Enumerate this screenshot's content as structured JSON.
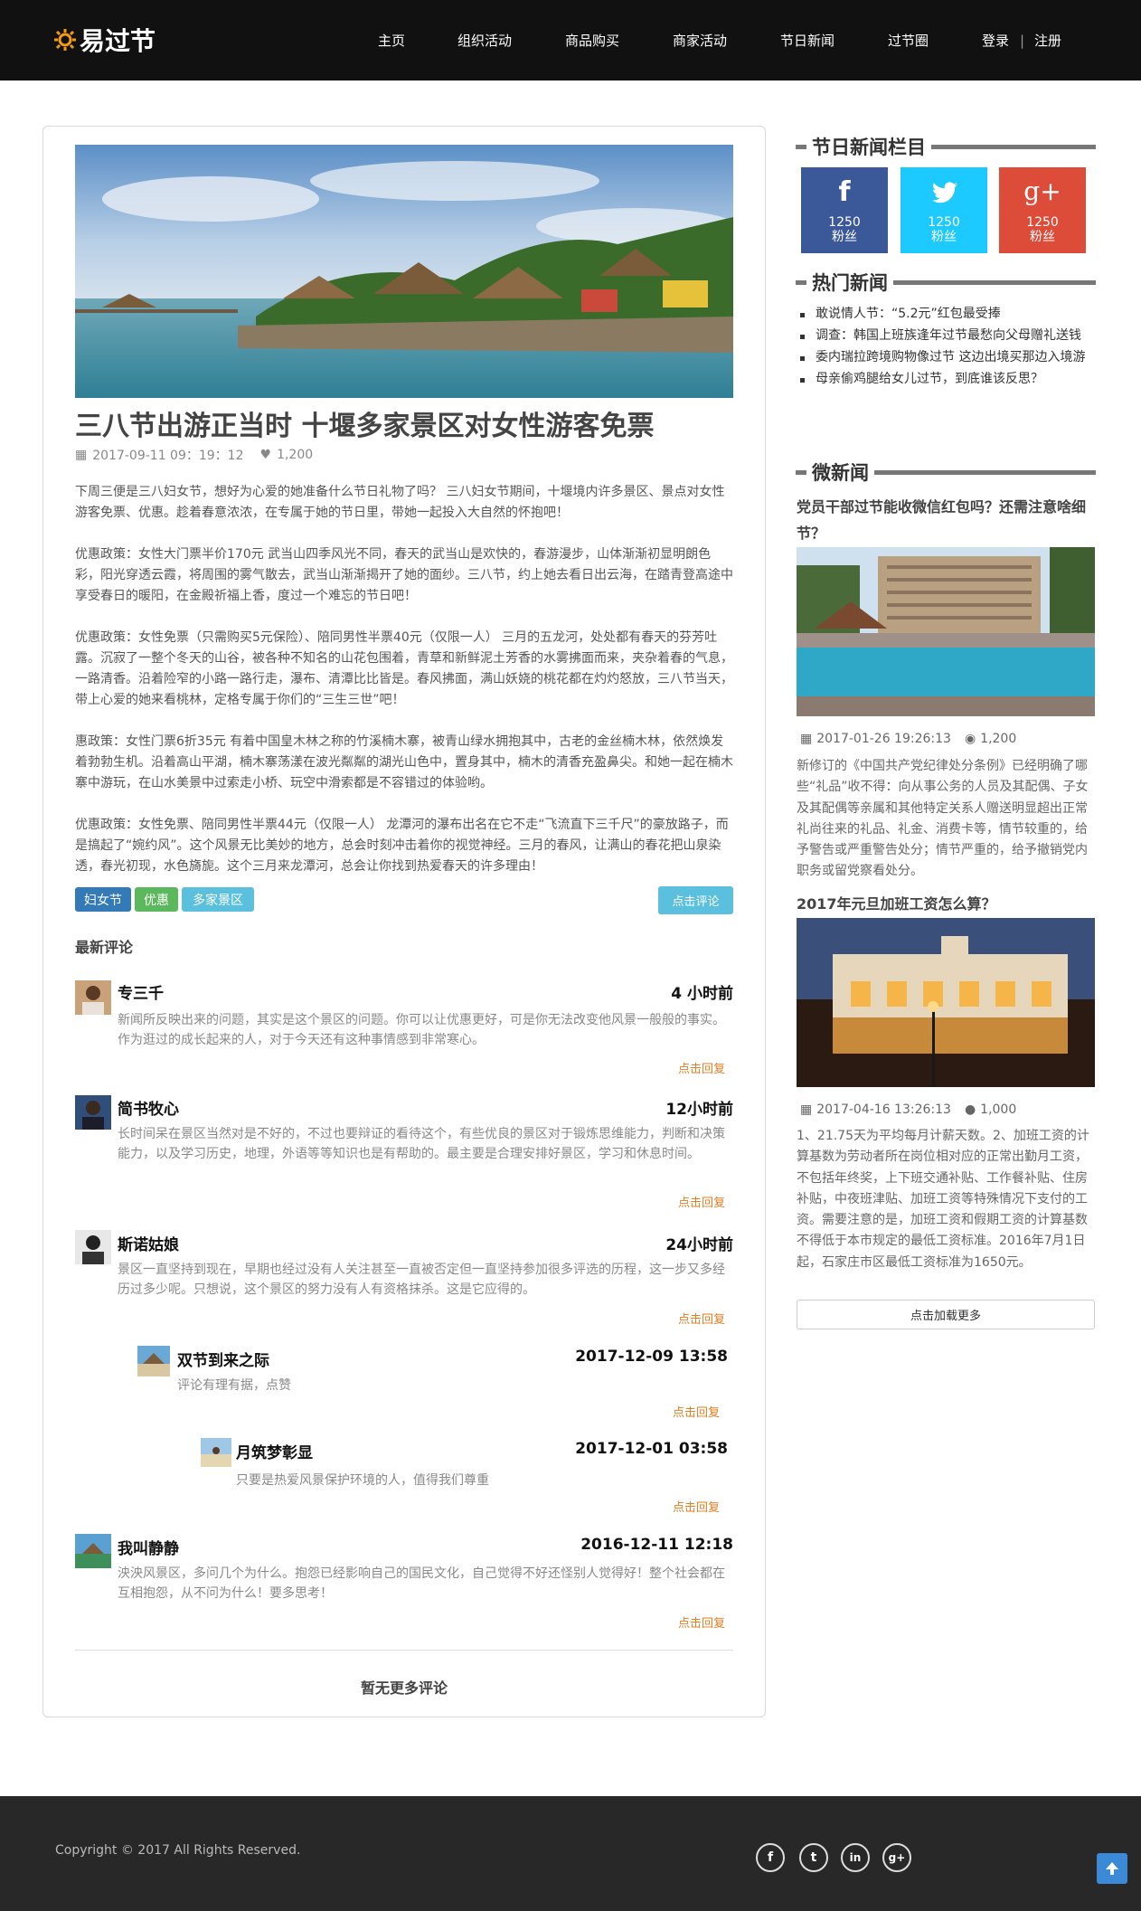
{
  "nav": {
    "logo_text": "易过节",
    "items": [
      "主页",
      "组织活动",
      "商品购买",
      "商家活动",
      "节日新闻",
      "过节圈"
    ],
    "login": "登录",
    "separator": "|",
    "register": "注册"
  },
  "article": {
    "title": "三八节出游正当时 十堰多家景区对女性游客免票",
    "date": "2017-09-11 09：19：12",
    "likes": "1,200",
    "paragraphs": [
      "下周三便是三八妇女节，想好为心爱的她准备什么节日礼物了吗？ 三八妇女节期间，十堰境内许多景区、景点对女性游客免票、优惠。趁着春意浓浓，在专属于她的节日里，带她一起投入大自然的怀抱吧！",
      "优惠政策：女性大门票半价170元 武当山四季风光不同，春天的武当山是欢快的，春游漫步，山体渐渐初显明朗色彩，阳光穿透云霞，将周围的雾气散去，武当山渐渐揭开了她的面纱。三八节，约上她去看日出云海，在踏青登高途中享受春日的暖阳，在金殿祈福上香，度过一个难忘的节日吧！",
      "优惠政策：女性免票（只需购买5元保险）、陪同男性半票40元（仅限一人） 三月的五龙河，处处都有春天的芬芳吐露。沉寂了一整个冬天的山谷，被各种不知名的山花包围着，青草和新鲜泥土芳香的水雾拂面而来，夹杂着春的气息，一路清香。沿着险窄的小路一路行走，瀑布、清潭比比皆是。春风拂面，满山妖娆的桃花都在灼灼怒放，三八节当天，带上心爱的她来看桃林，定格专属于你们的“三生三世”吧！",
      "惠政策：女性门票6折35元 有着中国皇木林之称的竹溪楠木寨，被青山绿水拥抱其中，古老的金丝楠木林，依然焕发着勃勃生机。沿着高山平湖，楠木寨荡漾在波光粼粼的湖光山色中，置身其中，楠木的清香充盈鼻尖。和她一起在楠木寨中游玩，在山水美景中过索走小桥、玩空中滑索都是不容错过的体验哟。",
      "优惠政策：女性免票、陪同男性半票44元（仅限一人） 龙潭河的瀑布出名在它不走“飞流直下三千尺”的豪放路子，而是搞起了“婉约风”。这个风景无比美妙的地方，总会时刻冲击着你的视觉神经。三月的春风，让满山的春花把山泉染透，春光初现，水色旖旎。这个三月来龙潭河，总会让你找到热爱春天的许多理由！"
    ],
    "tags": [
      "妇女节",
      "优惠",
      "多家景区"
    ],
    "comment_button": "点击评论"
  },
  "comments": {
    "heading": "最新评论",
    "items": [
      {
        "name": "专三千",
        "time": "4 小时前",
        "text": "新闻所反映出来的问题，其实是这个景区的问题。你可以让优惠更好，可是你无法改变他风景一般般的事实。作为逛过的成长起来的人，对于今天还有这种事情感到非常寒心。",
        "reply": "点击回复"
      },
      {
        "name": "简书牧心",
        "time": "12小时前",
        "text": "长时间呆在景区当然对是不好的，不过也要辩证的看待这个，有些优良的景区对于锻炼思维能力，判断和决策能力，以及学习历史，地理，外语等等知识也是有帮助的。最主要是合理安排好景区，学习和休息时间。",
        "reply": "点击回复"
      },
      {
        "name": "斯诺姑娘",
        "time": "24小时前",
        "text": "景区一直坚持到现在，早期也经过没有人关注甚至一直被否定但一直坚持参加很多评选的历程，这一步又多经历过多少呢。只想说，这个景区的努力没有人有资格抹杀。这是它应得的。",
        "reply": "点击回复"
      },
      {
        "name": "双节到来之际",
        "time": "2017-12-09 13:58",
        "text": "评论有理有据，点赞",
        "reply": "点击回复"
      },
      {
        "name": "月筑梦彰显",
        "time": "2017-12-01 03:58",
        "text": "只要是热爱风景保护环境的人，值得我们尊重",
        "reply": "点击回复"
      },
      {
        "name": "我叫静静",
        "time": "2016-12-11 12:18",
        "text": "泱泱风景区，多问几个为什么。抱怨已经影响自己的国民文化，自己觉得不好还怪别人觉得好！整个社会都在互相抱怨，从不问为什么！要多思考！",
        "reply": "点击回复"
      }
    ],
    "no_more": "暂无更多评论"
  },
  "sidebar": {
    "section1": "节日新闻栏目",
    "social": [
      {
        "icon": "facebook-icon",
        "count": "1250",
        "label": "粉丝",
        "color": "#3b5998"
      },
      {
        "icon": "twitter-icon",
        "count": "1250",
        "label": "粉丝",
        "color": "#1dcaff"
      },
      {
        "icon": "google-plus-icon",
        "count": "1250",
        "label": "粉丝",
        "color": "#dd4b39"
      }
    ],
    "section2": "热门新闻",
    "hot": [
      "敢说情人节：“5.2元”红包最受捧",
      "调查：韩国上班族逢年过节最愁向父母赠礼送钱",
      "委内瑞拉跨境购物像过节 这边出境买那边入境游",
      "母亲偷鸡腿给女儿过节，到底谁该反思？"
    ],
    "section3": "微新闻",
    "news": [
      {
        "title": "党员干部过节能收微信红包吗？还需注意啥细节？",
        "date": "2017-01-26 19:26:13",
        "count": "1,200",
        "text": "新修订的《中国共产党纪律处分条例》已经明确了哪些“礼品”收不得：向从事公务的人员及其配偶、子女及其配偶等亲属和其他特定关系人赠送明显超出正常礼尚往来的礼品、礼金、消费卡等，情节较重的，给予警告或严重警告处分；情节严重的，给予撤销党内职务或留党察看处分。"
      },
      {
        "title": "2017年元旦加班工资怎么算？",
        "date": "2017-04-16 13:26:13",
        "count": "1,000",
        "text": "1、21.75天为平均每月计薪天数。2、加班工资的计算基数为劳动者所在岗位相对应的正常出勤月工资，不包括年终奖，上下班交通补贴、工作餐补贴、住房补贴，中夜班津贴、加班工资等特殊情况下支付的工资。需要注意的是，加班工资和假期工资的计算基数不得低于本市规定的最低工资标准。2016年7月1日起，石家庄市区最低工资标准为1650元。"
      }
    ],
    "load_more": "点击加载更多"
  },
  "footer": {
    "copyright": "Copyright © 2017 All Rights Reserved.",
    "social": [
      "f",
      "t",
      "in",
      "g+"
    ]
  }
}
